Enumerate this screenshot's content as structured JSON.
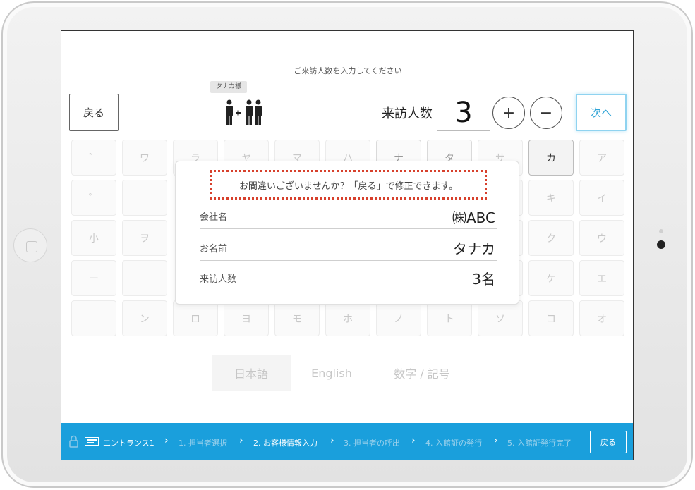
{
  "prompt": "ご来訪人数を入力してください",
  "back_label": "戻る",
  "name_tag": "タナカ様",
  "count_label": "来訪人数",
  "count_value": "3",
  "plus": "+",
  "minus": "−",
  "next_label": "次へ",
  "keys": [
    [
      "゛",
      "ワ",
      "ラ",
      "ヤ",
      "マ",
      "ハ",
      "ナ",
      "タ",
      "サ",
      "カ",
      "ア"
    ],
    [
      "゜",
      "",
      "",
      "",
      "",
      "",
      "",
      "",
      "",
      "キ",
      "イ"
    ],
    [
      "小",
      "ヲ",
      "",
      "",
      "",
      "",
      "",
      "",
      "",
      "ク",
      "ウ"
    ],
    [
      "ー",
      "",
      "",
      "",
      "",
      "",
      "",
      "",
      "",
      "ケ",
      "エ"
    ],
    [
      "",
      "ン",
      "ロ",
      "ヨ",
      "モ",
      "ホ",
      "ノ",
      "ト",
      "ソ",
      "コ",
      "オ"
    ]
  ],
  "languages": [
    "日本語",
    "English",
    "数字 / 記号"
  ],
  "popup": {
    "warning": "お間違いございませんか？「戻る」で修正できます。",
    "rows": [
      {
        "label": "会社名",
        "value": "㈱ABC"
      },
      {
        "label": "お名前",
        "value": "タナカ"
      },
      {
        "label": "来訪人数",
        "value": "3名"
      }
    ]
  },
  "status_bar": {
    "entrance": "エントランス1",
    "steps": [
      "1. 担当者選択",
      "2. お客様情報入力",
      "3. 担当者の呼出",
      "4. 入館証の発行",
      "5. 入館証発行完了"
    ],
    "current_step": 1,
    "back_label": "戻る"
  },
  "colors": {
    "accent": "#1a9fdc",
    "warning_border": "#d7402c",
    "next_border": "#8fd3f0"
  }
}
